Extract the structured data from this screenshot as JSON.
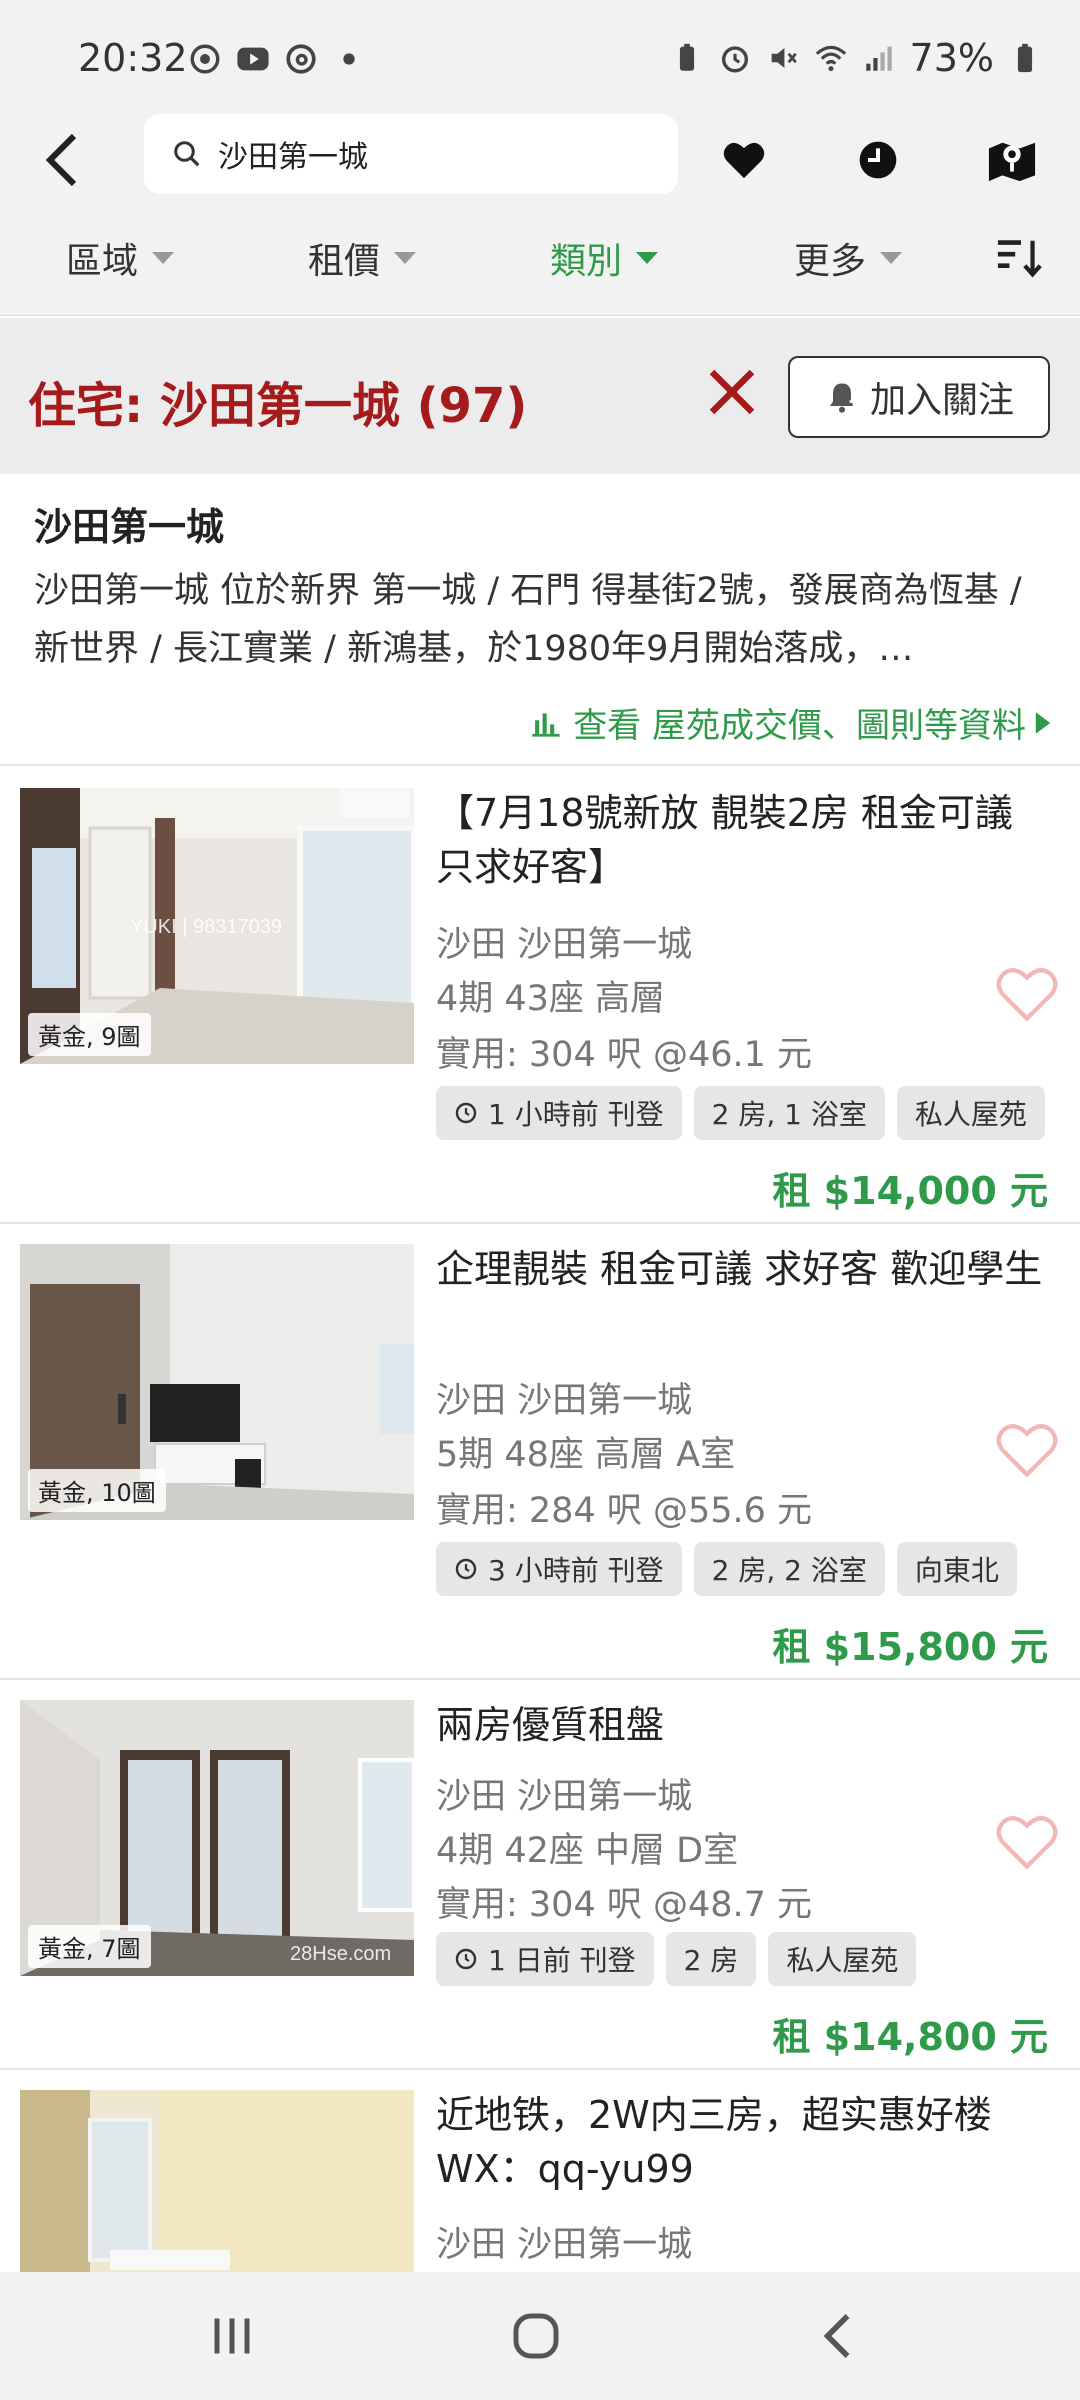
{
  "status": {
    "time": "20:32",
    "battery": "73%"
  },
  "search": {
    "query": "沙田第一城"
  },
  "filters": [
    {
      "label": "區域",
      "active": false
    },
    {
      "label": "租價",
      "active": false
    },
    {
      "label": "類別",
      "active": true
    },
    {
      "label": "更多",
      "active": false
    }
  ],
  "header": {
    "title": "住宅: 沙田第一城 (97)",
    "follow_label": "加入關注"
  },
  "estate": {
    "name": "沙田第一城",
    "description": "沙田第一城 位於新界 第一城 / 石門 得基街2號，發展商為恆基 / 新世界 / 長江實業 / 新鴻基，於1980年9月開始落成，…",
    "link_label": "查看 屋苑成交價、圖則等資料"
  },
  "listings": [
    {
      "title": "【7月18號新放  靚裝2房 租金可議 只求好客】",
      "district": "沙田  沙田第一城",
      "unit": "4期 43座 高層",
      "area": "實用: 304 呎   @46.1 元",
      "photo_tag": "黃金, 9圖",
      "watermark": "YUKI | 98317039",
      "tags": [
        "1 小時前 刊登",
        "2 房, 1 浴室",
        "私人屋苑"
      ],
      "price": "租 $14,000 元"
    },
    {
      "title": "企理靚裝 租金可議 求好客 歡迎學生",
      "district": "沙田  沙田第一城",
      "unit": "5期 48座 高層 A室",
      "area": "實用: 284 呎   @55.6 元",
      "photo_tag": "黃金, 10圖",
      "tags": [
        "3 小時前 刊登",
        "2 房, 2 浴室",
        "向東北"
      ],
      "price": "租 $15,800 元"
    },
    {
      "title": "兩房優質租盤",
      "district": "沙田  沙田第一城",
      "unit": "4期 42座 中層 D室",
      "area": "實用: 304 呎   @48.7 元",
      "photo_tag": "黃金, 7圖",
      "watermark": "28Hse.com",
      "tags": [
        "1 日前 刊登",
        "2 房",
        "私人屋苑"
      ],
      "price": "租 $14,800 元"
    },
    {
      "title": "近地铁，2W内三房，超实惠好楼WX：qq-yu99",
      "district": "沙田  沙田第一城"
    }
  ],
  "colors": {
    "accent_green": "#2e9a4a",
    "header_red": "#a51b1b",
    "heart_pink": "#f2b8b8"
  }
}
